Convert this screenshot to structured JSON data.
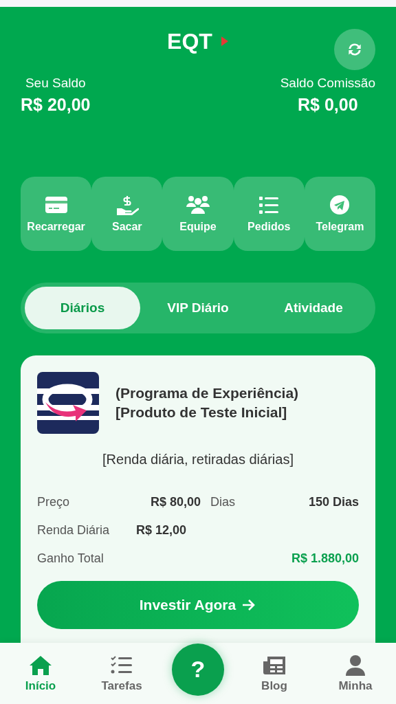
{
  "header": {
    "title": "EQT",
    "refresh": true
  },
  "balances": [
    {
      "label": "Seu Saldo",
      "value": "R$ 20,00"
    },
    {
      "label": "Saldo Comissão",
      "value": "R$ 0,00"
    }
  ],
  "actions": [
    {
      "kind": "card",
      "label": "Recarregar"
    },
    {
      "kind": "withdraw",
      "label": "Sacar"
    },
    {
      "kind": "team",
      "label": "Equipe"
    },
    {
      "kind": "list",
      "label": "Pedidos"
    },
    {
      "kind": "telegram",
      "label": "Telegram"
    }
  ],
  "tabs": [
    {
      "label": "Diários",
      "selected": true
    },
    {
      "label": "VIP Diário",
      "selected": false
    },
    {
      "label": "Atividade",
      "selected": false
    }
  ],
  "product": {
    "title_lines": [
      "(Programa de Experiência)",
      "[Produto de Teste Inicial]"
    ],
    "subtitle": "[Renda diária, retiradas diárias]",
    "rows": [
      [
        {
          "label": "Preço",
          "value": "R$ 80,00"
        },
        {
          "label": "Dias",
          "value": "150 Dias"
        }
      ],
      [
        {
          "label": "Renda Diária",
          "value": "R$ 12,00"
        }
      ],
      [
        {
          "label": "Ganho Total",
          "value": "R$ 1.880,00",
          "highlight": true
        }
      ]
    ],
    "button": "Investir Agora"
  },
  "nav": [
    {
      "kind": "home",
      "label": "Início",
      "selected": true
    },
    {
      "kind": "tasks",
      "label": "Tarefas",
      "selected": false
    },
    {
      "kind": "help",
      "glyph": "?"
    },
    {
      "kind": "blog",
      "label": "Blog",
      "selected": false
    },
    {
      "kind": "user",
      "label": "Minha",
      "selected": false
    }
  ]
}
